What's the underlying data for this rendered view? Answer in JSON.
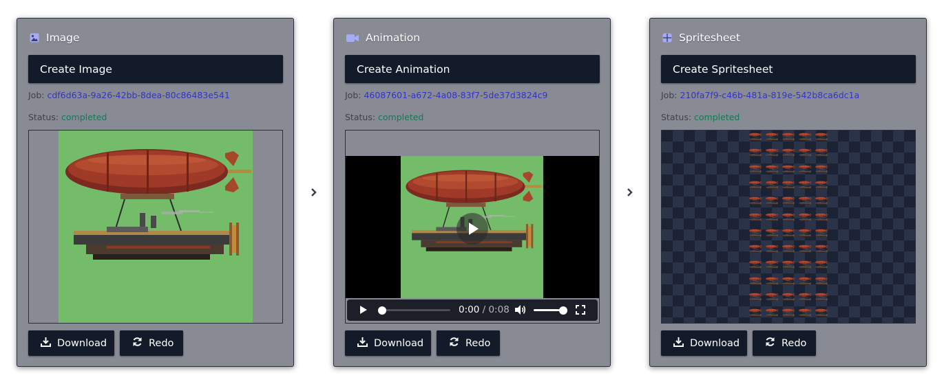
{
  "cards": [
    {
      "title": "Image",
      "icon": "image-icon",
      "create_label": "Create Image",
      "job_label": "Job:",
      "job_id": "cdf6d63a-9a26-42bb-8dea-80c86483e541",
      "status_label": "Status:",
      "status_value": "completed",
      "download_label": "Download",
      "redo_label": "Redo"
    },
    {
      "title": "Animation",
      "icon": "video-camera-icon",
      "create_label": "Create Animation",
      "job_label": "Job:",
      "job_id": "46087601-a672-4a08-83f7-5de37d3824c9",
      "status_label": "Status:",
      "status_value": "completed",
      "download_label": "Download",
      "redo_label": "Redo",
      "video": {
        "current_time": "0:00",
        "separator": " / ",
        "duration": "0:08",
        "progress": 0.0,
        "volume": 1.0
      }
    },
    {
      "title": "Spritesheet",
      "icon": "grid-icon",
      "create_label": "Create Spritesheet",
      "job_label": "Job:",
      "job_id": "210fa7f9-c46b-481a-819e-542b8ca6dc1a",
      "status_label": "Status:",
      "status_value": "completed",
      "download_label": "Download",
      "redo_label": "Redo"
    }
  ],
  "colors": {
    "card_bg": "#888a94",
    "button_bg": "#131a2a",
    "job_link": "#3434c6",
    "status_completed": "#127a54",
    "icon_accent": "#a6acf4",
    "image_bg": "#74bc6a"
  }
}
